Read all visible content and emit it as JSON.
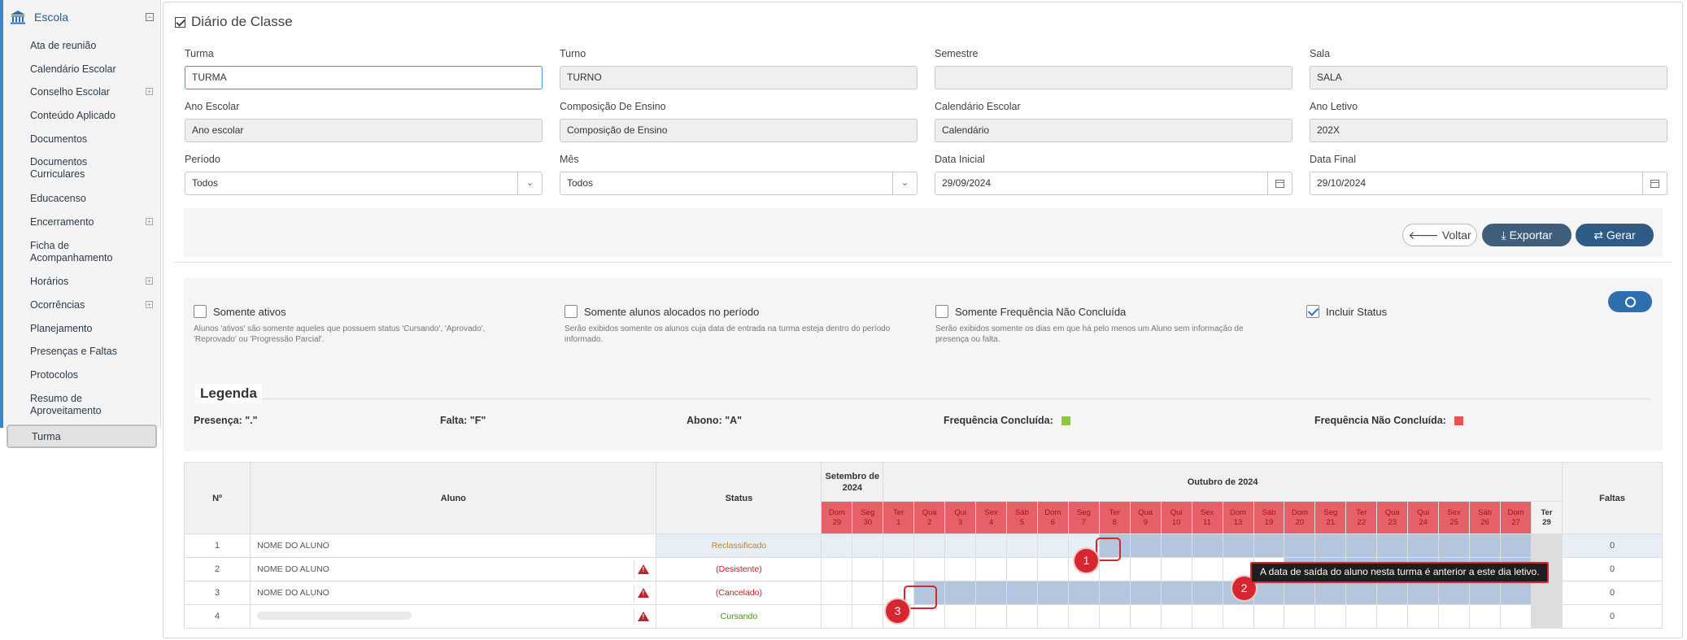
{
  "sidebar": {
    "title": "Escola",
    "collapse_glyph": "⊟",
    "items": [
      {
        "label": "Ata de reunião",
        "expandable": false
      },
      {
        "label": "Calendário Escolar",
        "expandable": false
      },
      {
        "label": "Conselho Escolar",
        "expandable": true
      },
      {
        "label": "Conteúdo Aplicado",
        "expandable": false
      },
      {
        "label": "Documentos",
        "expandable": false
      },
      {
        "label": "Documentos Curriculares",
        "expandable": false
      },
      {
        "label": "Educacenso",
        "expandable": false
      },
      {
        "label": "Encerramento",
        "expandable": true
      },
      {
        "label": "Ficha de Acompanhamento",
        "expandable": false
      },
      {
        "label": "Horários",
        "expandable": true
      },
      {
        "label": "Ocorrências",
        "expandable": true
      },
      {
        "label": "Planejamento",
        "expandable": false
      },
      {
        "label": "Presenças e Faltas",
        "expandable": false
      },
      {
        "label": "Protocolos",
        "expandable": false
      },
      {
        "label": "Resumo de Aproveitamento",
        "expandable": false
      },
      {
        "label": "Turma",
        "expandable": false,
        "active": true
      }
    ]
  },
  "page": {
    "title": "Diário de Classe"
  },
  "form": {
    "turma": {
      "label": "Turma",
      "value": "TURMA"
    },
    "turno": {
      "label": "Turno",
      "value": "TURNO"
    },
    "semestre": {
      "label": "Semestre",
      "value": ""
    },
    "sala": {
      "label": "Sala",
      "value": "SALA"
    },
    "ano_escolar": {
      "label": "Ano Escolar",
      "value": "Ano escolar"
    },
    "composicao": {
      "label": "Composição De Ensino",
      "value": "Composição de Ensino"
    },
    "calendario": {
      "label": "Calendário Escolar",
      "value": "Calendário"
    },
    "ano_letivo": {
      "label": "Ano Letivo",
      "value": "202X"
    },
    "periodo": {
      "label": "Período",
      "value": "Todos"
    },
    "mes": {
      "label": "Mês",
      "value": "Todos"
    },
    "data_inicial": {
      "label": "Data Inicial",
      "value": "29/09/2024"
    },
    "data_final": {
      "label": "Data Final",
      "value": "29/10/2024"
    }
  },
  "actions": {
    "voltar": "Voltar",
    "exportar": "Exportar",
    "gerar": "Gerar"
  },
  "filters": [
    {
      "label": "Somente ativos",
      "checked": false,
      "hint": "Alunos 'ativos' são somente aqueles que possuem status 'Cursando', 'Aprovado', 'Reprovado' ou 'Progressão Parcial'."
    },
    {
      "label": "Somente alunos alocados no período",
      "checked": false,
      "hint": "Serão exibidos somente os alunos cuja data de entrada na turma esteja dentro do período informado."
    },
    {
      "label": "Somente Frequência Não Concluída",
      "checked": false,
      "hint": "Serão exibidos somente os dias em que há pelo menos um Aluno sem informação de presença ou falta."
    },
    {
      "label": "Incluir Status",
      "checked": true,
      "hint": ""
    }
  ],
  "legend": {
    "title": "Legenda",
    "presenca": "Presença: \".\"",
    "falta": "Falta: \"F\"",
    "abono": "Abono: \"A\"",
    "concluida": "Frequência Concluída:",
    "nao_concluida": "Frequência Não Concluída:",
    "concluida_color": "#8dc63f",
    "nao_concluida_color": "#e35454"
  },
  "grid": {
    "headers": {
      "n": "Nº",
      "aluno": "Aluno",
      "status": "Status",
      "faltas": "Faltas",
      "sep_month": "Setembro de 2024",
      "oct_month": "Outubro de 2024"
    },
    "days": [
      {
        "w": "Dom",
        "d": "29"
      },
      {
        "w": "Seg",
        "d": "30"
      },
      {
        "w": "Ter",
        "d": "1"
      },
      {
        "w": "Qua",
        "d": "2"
      },
      {
        "w": "Qui",
        "d": "3"
      },
      {
        "w": "Sex",
        "d": "4"
      },
      {
        "w": "Sáb",
        "d": "5"
      },
      {
        "w": "Dom",
        "d": "6"
      },
      {
        "w": "Seg",
        "d": "7"
      },
      {
        "w": "Ter",
        "d": "8"
      },
      {
        "w": "Qua",
        "d": "9"
      },
      {
        "w": "Qui",
        "d": "10"
      },
      {
        "w": "Sex",
        "d": "11"
      },
      {
        "w": "Dom",
        "d": "13"
      },
      {
        "w": "Sáb",
        "d": "19"
      },
      {
        "w": "Dom",
        "d": "20"
      },
      {
        "w": "Seg",
        "d": "21"
      },
      {
        "w": "Ter",
        "d": "22"
      },
      {
        "w": "Qua",
        "d": "23"
      },
      {
        "w": "Qui",
        "d": "24"
      },
      {
        "w": "Sex",
        "d": "25"
      },
      {
        "w": "Sáb",
        "d": "26"
      },
      {
        "w": "Dom",
        "d": "27"
      },
      {
        "w": "Ter",
        "d": "29",
        "current": true
      }
    ],
    "rows": [
      {
        "n": "1",
        "aluno": "NOME DO ALUNO",
        "status": "Reclassificado",
        "status_color": "#b9862f",
        "warn": false,
        "faltas": "0",
        "blocked_from": 9
      },
      {
        "n": "2",
        "aluno": "NOME DO ALUNO",
        "status": "(Desistente)",
        "status_color": "#c0222b",
        "warn": true,
        "faltas": "0",
        "blocked_from": 15
      },
      {
        "n": "3",
        "aluno": "NOME DO ALUNO",
        "status": "(Cancelado)",
        "status_color": "#c0222b",
        "warn": true,
        "faltas": "0",
        "blocked_from": 3
      },
      {
        "n": "4",
        "aluno": "",
        "status": "Cursando",
        "status_color": "#4d8a2a",
        "warn": true,
        "faltas": "0",
        "blocked_from": -1
      }
    ]
  },
  "callouts": [
    {
      "label": "1"
    },
    {
      "label": "2"
    },
    {
      "label": "3"
    }
  ],
  "tooltip": "A data de saída do aluno nesta turma é anterior a este dia letivo."
}
